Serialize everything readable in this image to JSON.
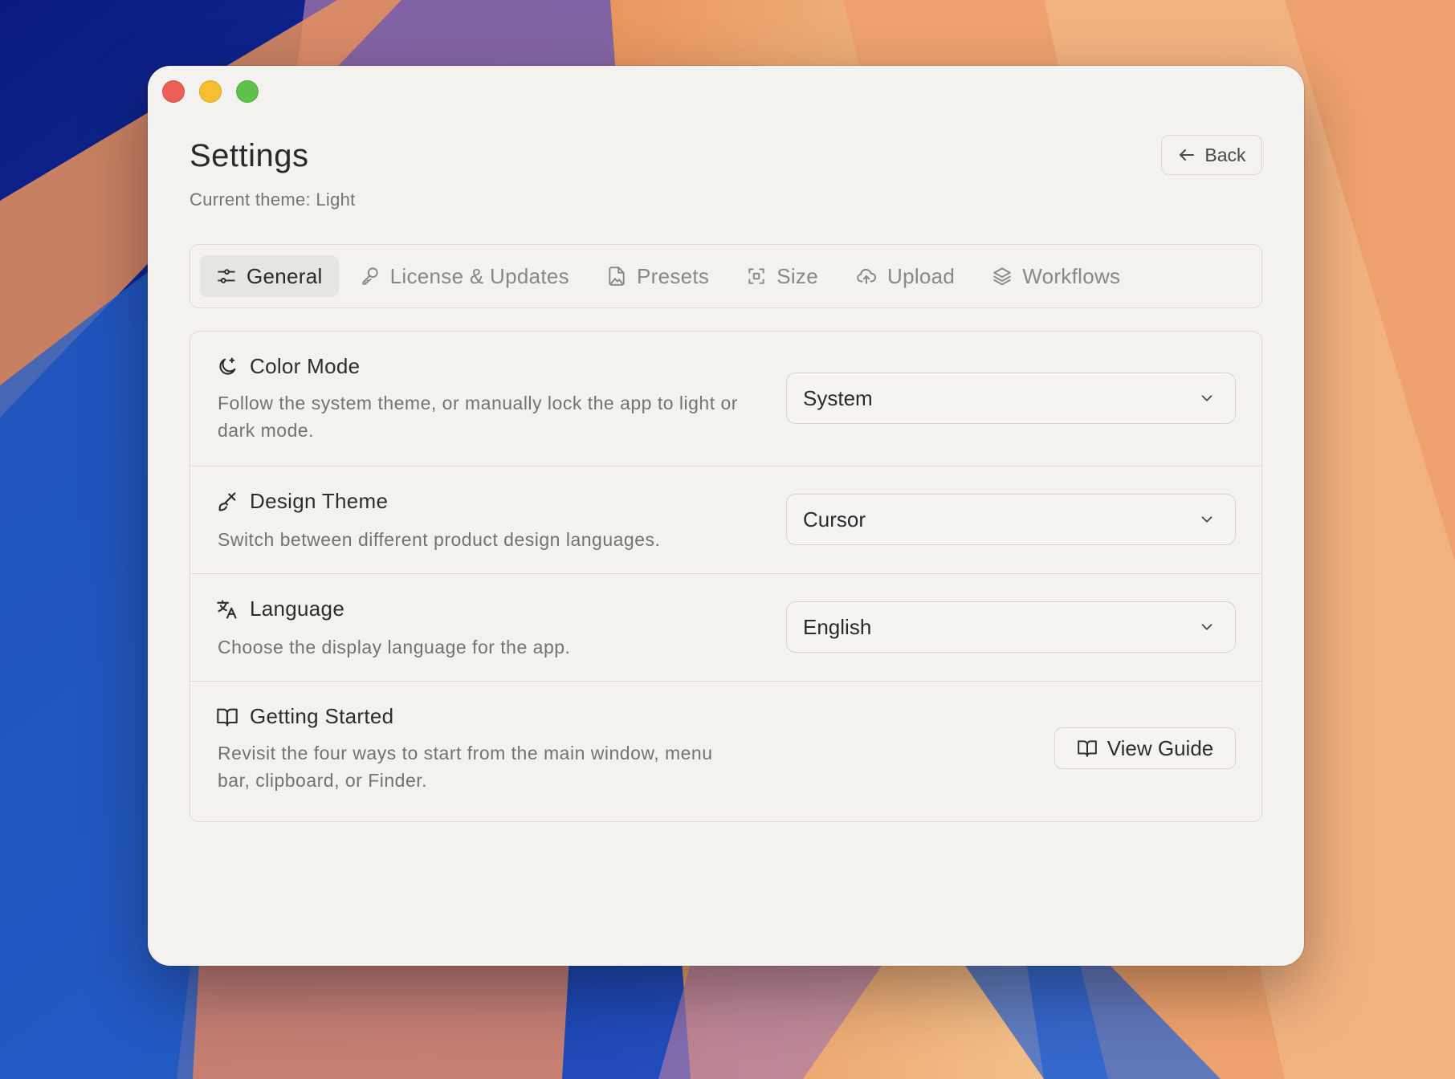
{
  "window": {
    "title": "Settings",
    "subtitle": "Current theme: Light",
    "back_label": "Back"
  },
  "tabs": [
    {
      "label": "General",
      "icon": "sliders-icon",
      "active": true
    },
    {
      "label": "License & Updates",
      "icon": "key-icon",
      "active": false
    },
    {
      "label": "Presets",
      "icon": "file-image-icon",
      "active": false
    },
    {
      "label": "Size",
      "icon": "resize-icon",
      "active": false
    },
    {
      "label": "Upload",
      "icon": "cloud-upload-icon",
      "active": false
    },
    {
      "label": "Workflows",
      "icon": "layers-icon",
      "active": false
    }
  ],
  "settings": [
    {
      "title": "Color Mode",
      "icon": "moon-sparkle-icon",
      "description": "Follow the system theme, or manually lock the app to light or dark mode.",
      "control": "select",
      "value": "System"
    },
    {
      "title": "Design Theme",
      "icon": "brush-icon",
      "description": "Switch between different product design languages.",
      "control": "select",
      "value": "Cursor"
    },
    {
      "title": "Language",
      "icon": "translate-icon",
      "description": "Choose the display language for the app.",
      "control": "select",
      "value": "English"
    },
    {
      "title": "Getting Started",
      "icon": "book-open-icon",
      "description": "Revisit the four ways to start from the main window, menu bar, clipboard, or Finder.",
      "control": "button",
      "button_label": "View Guide"
    }
  ],
  "colors": {
    "window_bg": "#f3f2ee",
    "border": "#dddbd4",
    "text_primary": "#2a2a2a",
    "text_secondary": "#75736e",
    "tab_active_bg": "#e6e5e0",
    "close": "#ee5e57",
    "minimize": "#f5c02f",
    "maximize": "#5dc14b"
  }
}
